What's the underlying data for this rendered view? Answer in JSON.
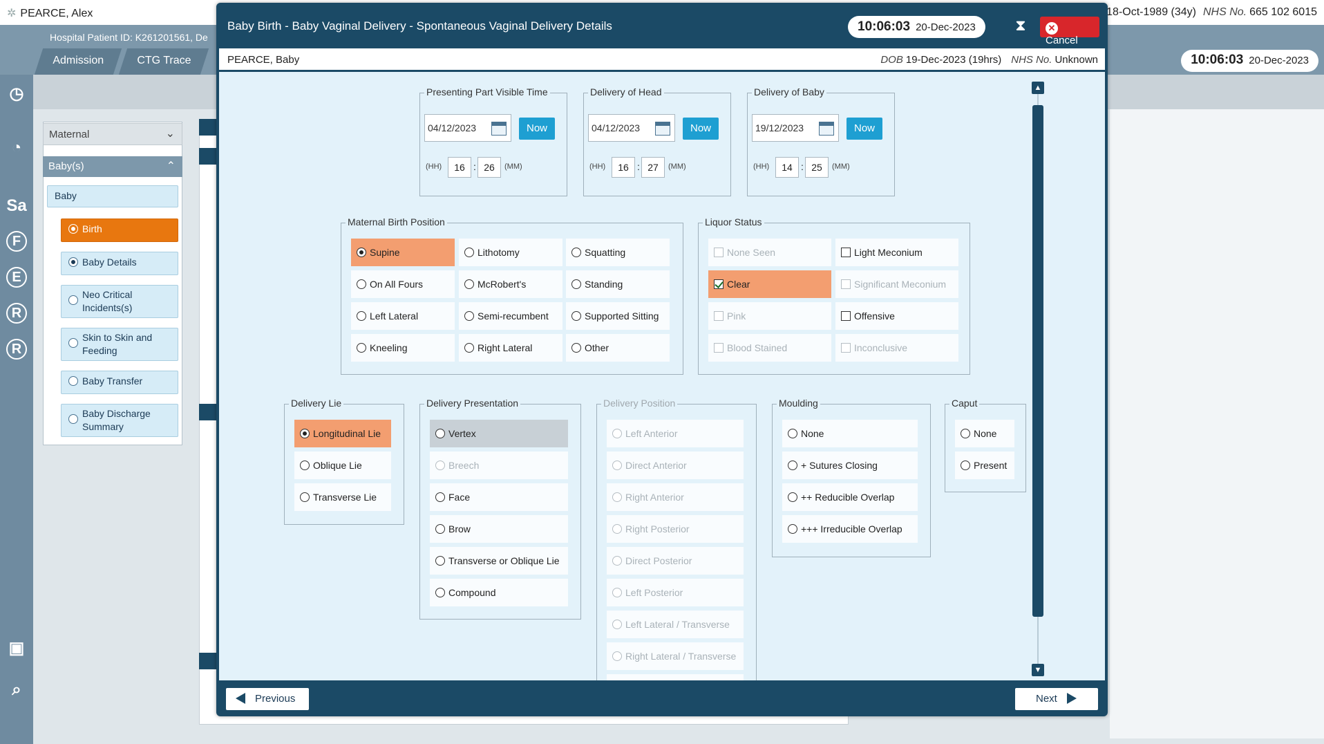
{
  "background": {
    "patient_name": "PEARCE, Alex",
    "dob": "18-Oct-1989 (34y)",
    "nhs_label": "NHS No.",
    "nhs_no": "665 102 6015",
    "hospital_id": "Hospital Patient ID: K261201561, De",
    "tabs": [
      "Admission",
      "CTG Trace"
    ],
    "clock_time": "10:06:03",
    "clock_date": "20-Dec-2023",
    "sidebar_letters": [
      "Sa",
      "F",
      "E",
      "R",
      "R"
    ],
    "dropdown_maternal": "Maternal",
    "dropdown_babies": "Baby(s)",
    "nav_header": "Baby",
    "nav_items": [
      "Birth",
      "Baby Details",
      "Neo Critical Incidents(s)",
      "Skin to Skin and Feeding",
      "Baby Transfer",
      "Baby Discharge Summary"
    ]
  },
  "modal": {
    "title": "Baby Birth - Baby Vaginal Delivery - Spontaneous Vaginal Delivery Details",
    "clock_time": "10:06:03",
    "clock_date": "20-Dec-2023",
    "cancel_label": "Cancel",
    "baby_name": "PEARCE, Baby",
    "dob_label": "DOB",
    "dob_value": "19-Dec-2023 (19hrs)",
    "nhs_label": "NHS No.",
    "nhs_value": "Unknown",
    "prev_label": "Previous",
    "next_label": "Next"
  },
  "time_groups": [
    {
      "legend": "Presenting Part Visible Time",
      "date": "04/12/2023",
      "hh": "16",
      "mm": "26",
      "now": "Now",
      "hh_label": "(HH)",
      "mm_label": "(MM)"
    },
    {
      "legend": "Delivery of Head",
      "date": "04/12/2023",
      "hh": "16",
      "mm": "27",
      "now": "Now",
      "hh_label": "(HH)",
      "mm_label": "(MM)"
    },
    {
      "legend": "Delivery of Baby",
      "date": "19/12/2023",
      "hh": "14",
      "mm": "25",
      "now": "Now",
      "hh_label": "(HH)",
      "mm_label": "(MM)"
    }
  ],
  "maternal_birth_position": {
    "legend": "Maternal Birth Position",
    "options": [
      "Supine",
      "Lithotomy",
      "Squatting",
      "On All Fours",
      "McRobert's",
      "Standing",
      "Left Lateral",
      "Semi-recumbent",
      "Supported Sitting",
      "Kneeling",
      "Right Lateral",
      "Other"
    ],
    "selected": "Supine"
  },
  "liquor_status": {
    "legend": "Liquor Status",
    "options": [
      "None Seen",
      "Light Meconium",
      "Clear",
      "Significant Meconium",
      "Pink",
      "Offensive",
      "Blood Stained",
      "Inconclusive"
    ],
    "checked": "Clear"
  },
  "delivery_lie": {
    "legend": "Delivery Lie",
    "options": [
      "Longitudinal Lie",
      "Oblique Lie",
      "Transverse Lie"
    ],
    "selected": "Longitudinal Lie"
  },
  "delivery_presentation": {
    "legend": "Delivery Presentation",
    "options": [
      "Vertex",
      "Breech",
      "Face",
      "Brow",
      "Transverse or Oblique Lie",
      "Compound"
    ]
  },
  "delivery_position": {
    "legend": "Delivery Position",
    "options": [
      "Left Anterior",
      "Direct Anterior",
      "Right Anterior",
      "Right Posterior",
      "Direct Posterior",
      "Left Posterior",
      "Left Lateral / Transverse",
      "Right Lateral / Transverse"
    ]
  },
  "moulding": {
    "legend": "Moulding",
    "options": [
      "None",
      "+ Sutures Closing",
      "++ Reducible Overlap",
      "+++ Irreducible Overlap"
    ]
  },
  "caput": {
    "legend": "Caput",
    "options": [
      "None",
      "Present"
    ]
  },
  "colors": {
    "header_navy": "#1b4a66",
    "selected_orange": "#f39e70",
    "active_nav_orange": "#e8770f",
    "now_blue": "#1e9fd2",
    "cancel_red": "#d8262b"
  }
}
